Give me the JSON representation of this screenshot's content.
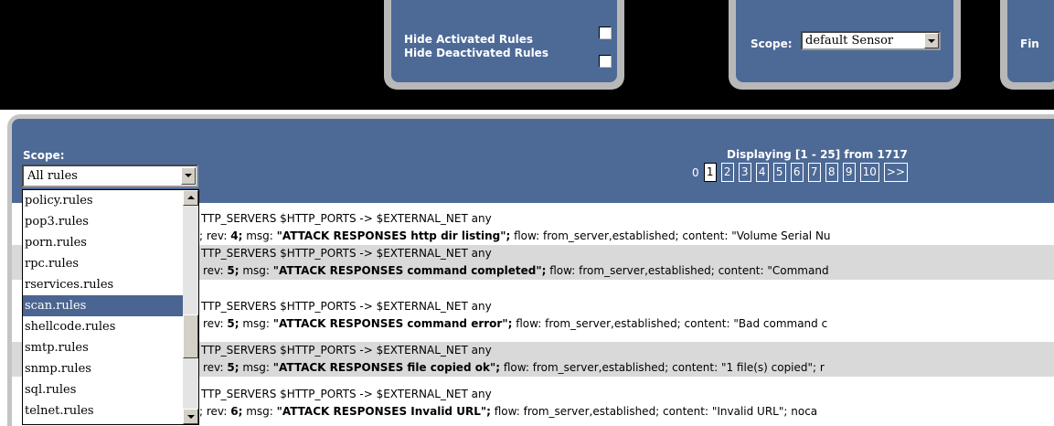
{
  "top": {
    "hide_activated_label": "Hide Activated Rules",
    "hide_deactivated_label": "Hide Deactivated Rules",
    "scope_label": "Scope:",
    "scope_value": "default Sensor",
    "cut_label": "Fin"
  },
  "filter": {
    "scope_label": "Scope:",
    "scope_value": "All rules",
    "options": [
      "policy.rules",
      "pop3.rules",
      "porn.rules",
      "rpc.rules",
      "rservices.rules",
      "scan.rules",
      "shellcode.rules",
      "smtp.rules",
      "snmp.rules",
      "sql.rules",
      "telnet.rules"
    ],
    "selected_option": "scan.rules"
  },
  "pagination": {
    "display_text": "Displaying [1 - 25] from 1717",
    "prefix": "0",
    "pages": [
      "1",
      "2",
      "3",
      "4",
      "5",
      "6",
      "7",
      "8",
      "9",
      "10",
      ">>"
    ],
    "active_page": "1"
  },
  "rules": [
    {
      "header": "TTP_SERVERS $HTTP_PORTS -> $EXTERNAL_NET any",
      "pre": "; rev: ",
      "rev": "4;",
      "msg_label": " msg: ",
      "msg": "\"ATTACK RESPONSES http dir listing\";",
      "tail": " flow: from_server,established; content: \"Volume Serial Nu"
    },
    {
      "header": "TTP_SERVERS $HTTP_PORTS -> $EXTERNAL_NET any",
      "pre": "rev: ",
      "rev": "5;",
      "msg_label": " msg: ",
      "msg": "\"ATTACK RESPONSES command completed\";",
      "tail": " flow: from_server,established; content: \"Command"
    },
    {
      "header": "TTP_SERVERS $HTTP_PORTS -> $EXTERNAL_NET any",
      "pre": "rev: ",
      "rev": "5;",
      "msg_label": " msg: ",
      "msg": "\"ATTACK RESPONSES command error\";",
      "tail": " flow: from_server,established; content: \"Bad command c"
    },
    {
      "header": "TTP_SERVERS $HTTP_PORTS -> $EXTERNAL_NET any",
      "pre": "rev: ",
      "rev": "5;",
      "msg_label": " msg: ",
      "msg": "\"ATTACK RESPONSES file copied ok\";",
      "tail": " flow: from_server,established; content: \"1 file(s) copied\"; r"
    },
    {
      "header": "TTP_SERVERS $HTTP_PORTS -> $EXTERNAL_NET any",
      "pre": "; rev: ",
      "rev": "6;",
      "msg_label": " msg: ",
      "msg": "\"ATTACK RESPONSES Invalid URL\";",
      "tail": " flow: from_server,established; content: \"Invalid URL\"; noca"
    }
  ]
}
